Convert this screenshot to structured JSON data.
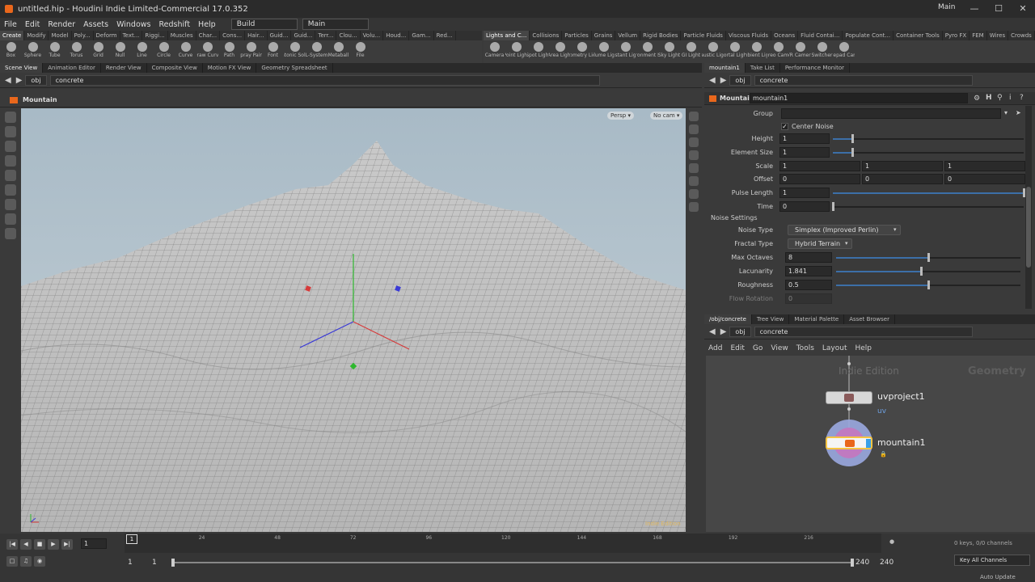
{
  "titlebar": {
    "title": "untitled.hip - Houdini Indie Limited-Commercial 17.0.352",
    "desktop": "Main",
    "min": "—",
    "max": "☐",
    "close": "✕"
  },
  "menubar": {
    "items": [
      "File",
      "Edit",
      "Render",
      "Assets",
      "Windows",
      "Redshift",
      "Help"
    ],
    "build": "Build",
    "main": "Main"
  },
  "shelf_left": {
    "tabs": [
      "Create",
      "Modify",
      "Model",
      "Poly...",
      "Deform",
      "Text...",
      "Riggi...",
      "Muscles",
      "Char...",
      "Cons...",
      "Hair...",
      "Guid...",
      "Guid...",
      "Terr...",
      "Clou...",
      "Volu...",
      "Houd...",
      "Gam...",
      "Red..."
    ],
    "tools": [
      "Box",
      "Sphere",
      "Tube",
      "Torus",
      "Grid",
      "Null",
      "Line",
      "Circle",
      "Curve",
      "Draw Curve",
      "Path",
      "Spray Paint",
      "Font",
      "Platonic Solids",
      "L-System",
      "Metaball",
      "File"
    ]
  },
  "shelf_right": {
    "tabs": [
      "Lights and C...",
      "Collisions",
      "Particles",
      "Grains",
      "Vellum",
      "Rigid Bodies",
      "Particle Fluids",
      "Viscous Fluids",
      "Oceans",
      "Fluid Contai...",
      "Populate Cont...",
      "Container Tools",
      "Pyro FX",
      "FEM",
      "Wires",
      "Crowds",
      "Drive Simula..."
    ],
    "tools": [
      "Camera",
      "Point Light",
      "Spot Light",
      "Area Light",
      "Geometry Light",
      "Volume Light",
      "Distant Light",
      "Environment Light",
      "Sky Light",
      "GI Light",
      "Caustic Light",
      "Portal Light",
      "Ambient Light",
      "Stereo Camera",
      "VR Camera",
      "Switcher",
      "Gamepad Camera"
    ]
  },
  "viewer": {
    "tabs": [
      "Scene View",
      "Animation Editor",
      "Render View",
      "Composite View",
      "Motion FX View",
      "Geometry Spreadsheet"
    ],
    "path": [
      "obj",
      "concrete"
    ],
    "node_title": "Mountain",
    "persp": "Persp ▾",
    "nocam": "No cam ▾",
    "watermark": "Indie Edition"
  },
  "params": {
    "tabs": [
      "mountain1",
      "Take List",
      "Performance Monitor"
    ],
    "path": [
      "obj",
      "concrete"
    ],
    "node_type": "Mountain",
    "node_name": "mountain1",
    "group_label": "Group",
    "center_noise": "Center Noise",
    "height_label": "Height",
    "height": "1",
    "height_level": 0.1,
    "element_size_label": "Element Size",
    "element_size": "1",
    "element_size_level": 0.1,
    "scale_label": "Scale",
    "scale": [
      "1",
      "1",
      "1"
    ],
    "offset_label": "Offset",
    "offset": [
      "0",
      "0",
      "0"
    ],
    "pulse_label": "Pulse Length",
    "pulse": "1",
    "pulse_level": 1.0,
    "time_label": "Time",
    "time": "0",
    "time_level": 0.0,
    "noise_settings": "Noise Settings",
    "noise_type_label": "Noise Type",
    "noise_type": "Simplex (Improved Perlin)",
    "fractal_type_label": "Fractal Type",
    "fractal_type": "Hybrid Terrain",
    "max_octaves_label": "Max Octaves",
    "max_octaves": "8",
    "max_octaves_level": 0.5,
    "lacunarity_label": "Lacunarity",
    "lacunarity": "1.841",
    "lacunarity_level": 0.46,
    "roughness_label": "Roughness",
    "roughness": "0.5",
    "roughness_level": 0.5,
    "flow_rotation_label": "Flow Rotation",
    "flow_rotation": "0"
  },
  "network": {
    "tabs": [
      "/obj/concrete",
      "Tree View",
      "Material Palette",
      "Asset Browser"
    ],
    "path": [
      "obj",
      "concrete"
    ],
    "menu": [
      "Add",
      "Edit",
      "Go",
      "View",
      "Tools",
      "Layout",
      "Help"
    ],
    "watermark": "Indie Edition",
    "context": "Geometry",
    "nodes": [
      {
        "name": "uvproject1",
        "sub": "uv"
      },
      {
        "name": "mountain1",
        "sub": ""
      }
    ]
  },
  "timeline": {
    "ticks": [
      "1",
      "24",
      "48",
      "72",
      "96",
      "120",
      "144",
      "168",
      "192",
      "216"
    ],
    "current_frame": "1",
    "marker": "1",
    "start": "1",
    "start2": "1",
    "end": "240",
    "end2": "240",
    "keys": "0 keys, 0/0 channels",
    "key_all": "Key All Channels",
    "auto_update": "Auto Update"
  },
  "colors": {
    "accent": "#e9671c",
    "selected_node": "#f5c443",
    "node_ring": "#9aa8e0",
    "slider_fill": "#3c6fa8"
  }
}
